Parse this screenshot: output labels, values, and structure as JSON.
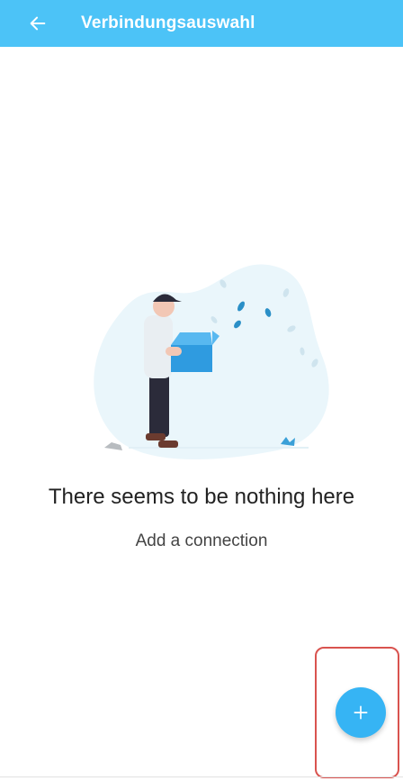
{
  "appbar": {
    "title": "Verbindungsauswahl",
    "back_icon": "arrow-left-icon",
    "background": "#4cc3f7"
  },
  "empty_state": {
    "illustration": "person-with-open-box",
    "title": "There seems to be nothing here",
    "subtitle": "Add a connection"
  },
  "fab": {
    "icon": "plus-icon",
    "color": "#36b4f4",
    "label": "+"
  }
}
